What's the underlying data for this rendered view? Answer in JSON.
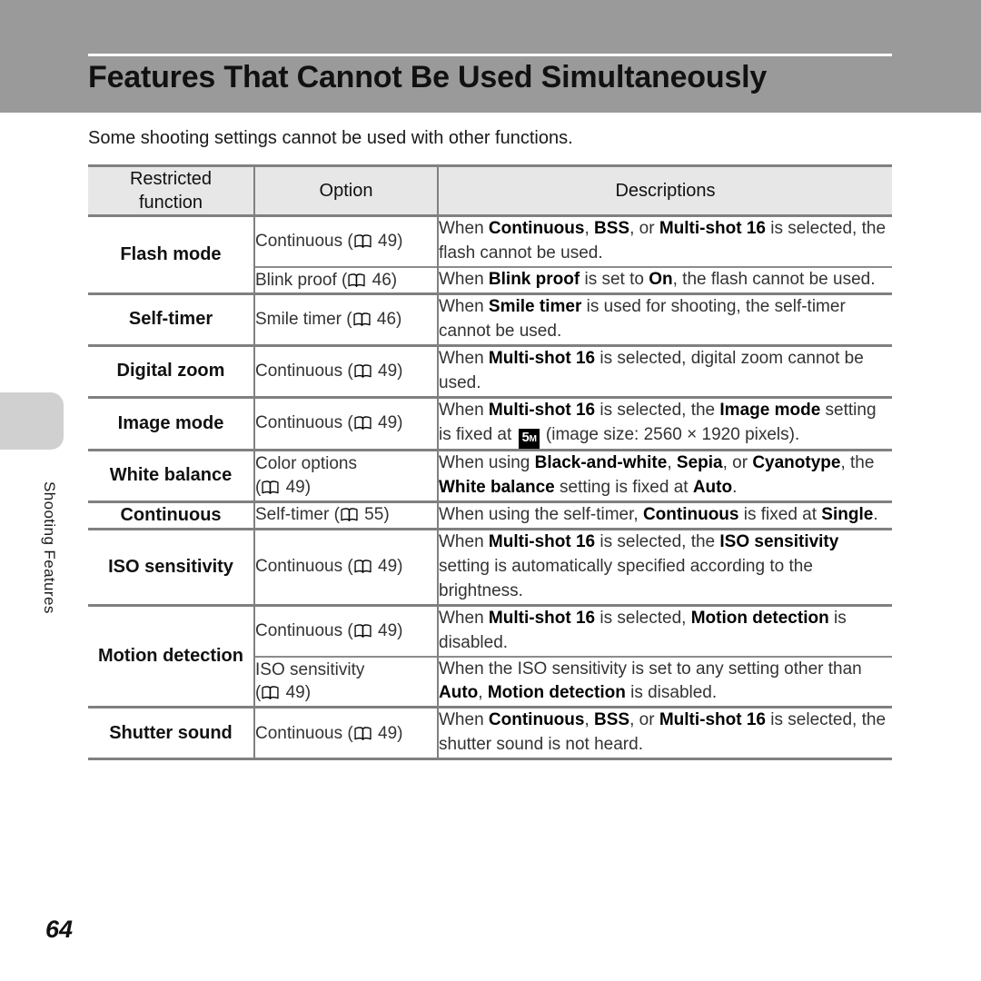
{
  "header": {
    "title": "Features That Cannot Be Used Simultaneously"
  },
  "intro": "Some shooting settings cannot be used with other functions.",
  "side_tab": {
    "label": "Shooting Features"
  },
  "footer": {
    "page_number": "64"
  },
  "icons": {
    "book": "book-icon",
    "image_size_badge": "5M"
  },
  "colors": {
    "header_band": "#9a9a9a",
    "table_header_bg": "#e7e7e7",
    "rule": "#808080",
    "side_tab": "#d0d0d0"
  },
  "table": {
    "columns": [
      "Restricted function",
      "Option",
      "Descriptions"
    ],
    "column_headers": {
      "c1_line1": "Restricted",
      "c1_line2": "function",
      "c2": "Option",
      "c3": "Descriptions"
    },
    "rows": [
      {
        "function": "Flash mode",
        "sub_rows": [
          {
            "option_pre": "Continuous (",
            "option_page": "49",
            "option_post": ")",
            "desc_html": "When <b>Continuous</b>, <b>BSS</b>, or <b>Multi-shot 16</b> is selected, the flash cannot be used."
          },
          {
            "option_pre": "Blink proof (",
            "option_page": "46",
            "option_post": ")",
            "desc_html": "When <b>Blink proof</b> is set to <b>On</b>, the flash cannot be used."
          }
        ]
      },
      {
        "function": "Self-timer",
        "sub_rows": [
          {
            "option_pre": "Smile timer (",
            "option_page": "46",
            "option_post": ")",
            "desc_html": "When <b>Smile timer</b> is used for shooting, the self-timer cannot be used."
          }
        ]
      },
      {
        "function": "Digital zoom",
        "sub_rows": [
          {
            "option_pre": "Continuous (",
            "option_page": "49",
            "option_post": ")",
            "desc_html": "When <b>Multi-shot 16</b> is selected, digital zoom cannot be used."
          }
        ]
      },
      {
        "function": "Image mode",
        "sub_rows": [
          {
            "option_pre": "Continuous (",
            "option_page": "49",
            "option_post": ")",
            "desc_html": "When <b>Multi-shot 16</b> is selected, the <b>Image mode</b> setting is fixed at <span class=\"badge-5m\">5<sub>M</sub></span> (image size: 2560 &times; 1920 pixels)."
          }
        ]
      },
      {
        "function": "White balance",
        "sub_rows": [
          {
            "option_pre": "Color options<br>(",
            "option_page": "49",
            "option_post": ")",
            "desc_html": "When using <b>Black-and-white</b>, <b>Sepia</b>, or <b>Cyanotype</b>, the <b>White balance</b> setting is fixed at <b>Auto</b>."
          }
        ]
      },
      {
        "function": "Continuous",
        "sub_rows": [
          {
            "option_pre": "Self-timer (",
            "option_page": "55",
            "option_post": ")",
            "desc_html": "When using the self-timer, <b>Continuous</b> is fixed at <b>Single</b>."
          }
        ]
      },
      {
        "function": "ISO sensitivity",
        "sub_rows": [
          {
            "option_pre": "Continuous (",
            "option_page": "49",
            "option_post": ")",
            "desc_html": "When <b>Multi-shot 16</b> is selected, the <b>ISO sensitivity</b> setting is automatically specified according to the brightness."
          }
        ]
      },
      {
        "function": "Motion detection",
        "sub_rows": [
          {
            "option_pre": "Continuous (",
            "option_page": "49",
            "option_post": ")",
            "desc_html": "When <b>Multi-shot 16</b> is selected, <b>Motion detection</b> is disabled."
          },
          {
            "option_pre": "ISO sensitivity<br>(",
            "option_page": "49",
            "option_post": ")",
            "desc_html": "When the ISO sensitivity is set to any setting other than <b>Auto</b>, <b>Motion detection</b> is disabled."
          }
        ]
      },
      {
        "function": "Shutter sound",
        "sub_rows": [
          {
            "option_pre": "Continuous (",
            "option_page": "49",
            "option_post": ")",
            "desc_html": "When <b>Continuous</b>, <b>BSS</b>, or <b>Multi-shot 16</b> is selected, the shutter sound is not heard."
          }
        ]
      }
    ]
  }
}
